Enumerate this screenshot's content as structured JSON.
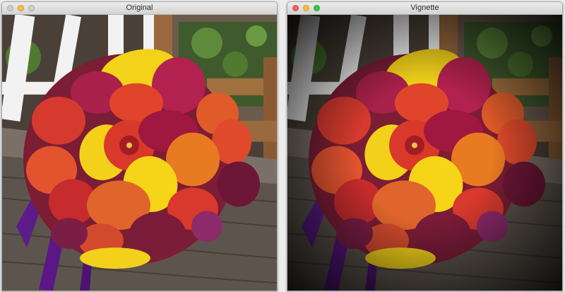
{
  "windows": [
    {
      "title": "Original",
      "traffic_lights": [
        "close",
        "minimize",
        "zoom"
      ],
      "active": false,
      "content": "bouquet-photo"
    },
    {
      "title": "Vignette",
      "traffic_lights": [
        "close",
        "minimize",
        "zoom"
      ],
      "active": true,
      "content": "bouquet-photo-vignette"
    }
  ],
  "colors": {
    "light_close": "#fc605c",
    "light_minimize": "#fdbc40",
    "light_zoom": "#34c84a",
    "titlebar": "#e2e2e2"
  }
}
